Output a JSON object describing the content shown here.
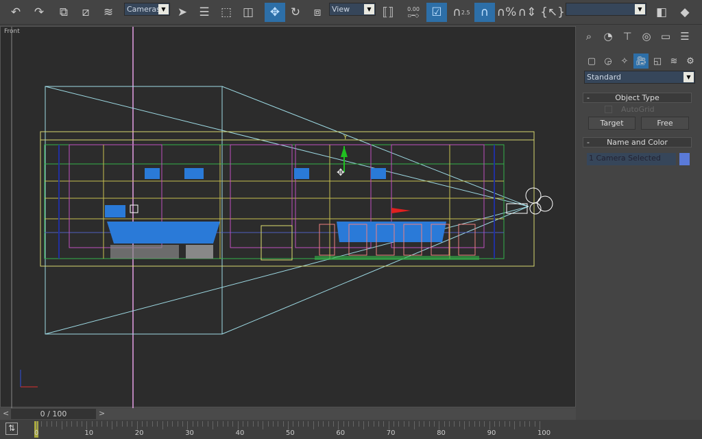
{
  "toolbar": {
    "buttons": [
      "undo-icon",
      "redo-icon",
      "select-link-icon",
      "unlink-icon",
      "bind-space-warp-icon",
      "select-object-icon",
      "select-by-name-icon",
      "rect-region-icon",
      "window-crossing-icon",
      "move-icon",
      "rotate-icon",
      "scale-icon",
      "mirror-align-icon",
      "spinner-snap-icon",
      "toggle-icon",
      "snap-2-5-icon",
      "angle-snap-icon",
      "percent-snap-icon",
      "spinner-snap-toggle-icon",
      "edit-named-selection-icon",
      "mirror-icon",
      "align-icon"
    ],
    "selection_filter": "Cameras",
    "reference_coord": "View",
    "snap_label": "2.5",
    "spinner_value": "0.00",
    "named_selection": ""
  },
  "viewport": {
    "label": "Front"
  },
  "command_panel": {
    "tabs": [
      "create-icon",
      "modify-icon",
      "hierarchy-icon",
      "motion-icon",
      "display-icon",
      "utilities-icon"
    ],
    "categories": [
      "geometry-icon",
      "shapes-icon",
      "lights-icon",
      "cameras-icon",
      "helpers-icon",
      "space-warps-icon",
      "systems-icon"
    ],
    "type_dropdown": "Standard",
    "object_type": {
      "title": "Object Type",
      "collapse": "-",
      "autogrid": "AutoGrid",
      "buttons": [
        "Target",
        "Free"
      ]
    },
    "name_color": {
      "title": "Name and Color",
      "collapse": "-",
      "name_value": "1 Camera Selected",
      "color": "#5a7ad8"
    }
  },
  "timeline": {
    "frame": "0 / 100",
    "prev": "<",
    "next": ">",
    "labels": [
      "0",
      "10",
      "20",
      "30",
      "40",
      "50",
      "60",
      "70",
      "80",
      "90",
      "100"
    ]
  },
  "colors": {
    "accent": "#2d6fa8"
  }
}
